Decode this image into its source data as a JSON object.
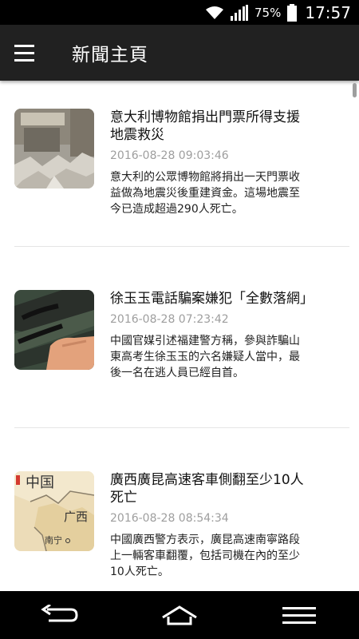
{
  "status_bar": {
    "battery_percent": "75%",
    "time": "17:57",
    "icons": [
      "wifi-icon",
      "signal-icon",
      "battery-icon"
    ]
  },
  "app_bar": {
    "title": "新聞主頁",
    "menu_icon": "hamburger-menu-icon"
  },
  "news": [
    {
      "title": "意大利博物館捐出門票所得支援地震救災",
      "date": "2016-08-28 09:03:46",
      "summary": "意大利的公眾博物館將捐出一天門票收益做為地震災後重建資金。這場地震至今已造成超過290人死亡。"
    },
    {
      "title": "徐玉玉電話騙案嫌犯「全數落網」",
      "date": "2016-08-28 07:23:42",
      "summary": "中國官媒引述福建警方稱，參與詐騙山東高考生徐玉玉的六名嫌疑人當中，最後一名在逃人員已經自首。"
    },
    {
      "title": "廣西廣昆高速客車側翻至少10人死亡",
      "date": "2016-08-28 08:54:34",
      "summary": "中國廣西警方表示，廣昆高速南寧路段上一輛客車翻覆，包括司機在內的至少10人死亡。",
      "thumb_map_labels": [
        "中国",
        "广西",
        "南宁"
      ]
    }
  ],
  "nav_bar": {
    "icons": [
      "back-icon",
      "home-icon",
      "recent-apps-icon"
    ]
  },
  "colors": {
    "status_bar": "#000000",
    "app_bar": "#212121",
    "date_text": "#9e9e9e",
    "nav_bar": "#000000"
  }
}
